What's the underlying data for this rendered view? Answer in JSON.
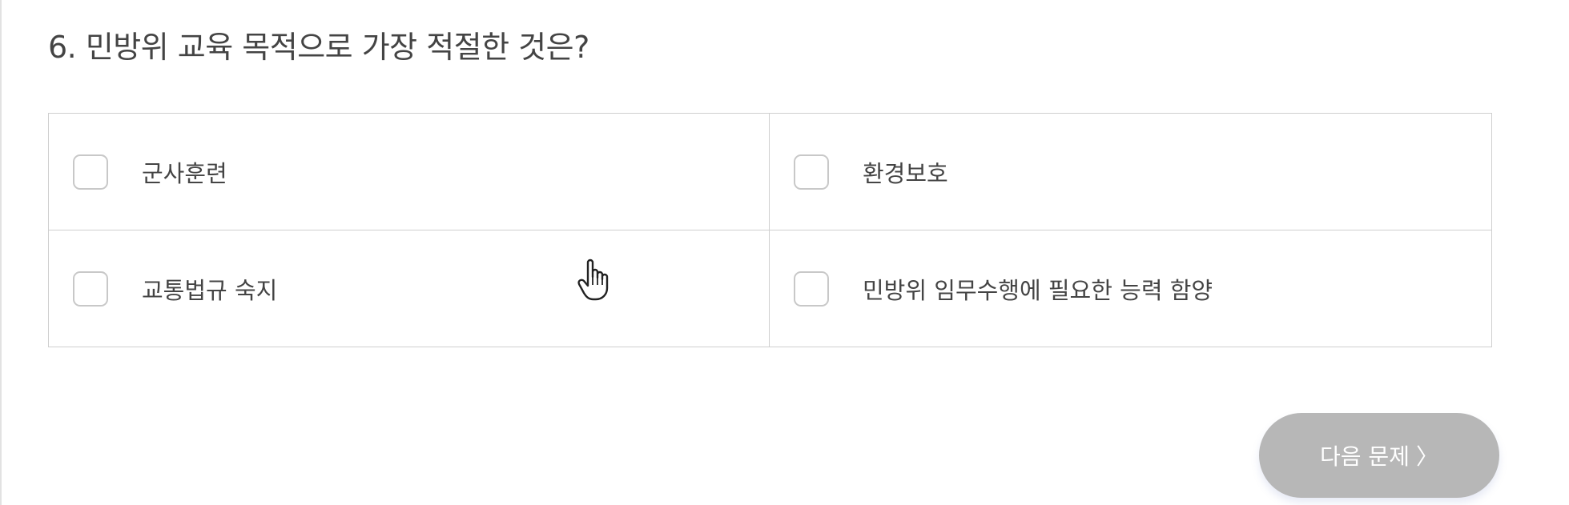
{
  "question": {
    "title": "6. 민방위 교육 목적으로 가장 적절한 것은?"
  },
  "options": [
    {
      "label": "군사훈련",
      "checked": false
    },
    {
      "label": "환경보호",
      "checked": false
    },
    {
      "label": "교통법규 숙지",
      "checked": false
    },
    {
      "label": "민방위 임무수행에 필요한 능력 함양",
      "checked": false
    }
  ],
  "next_button": {
    "label": "다음 문제",
    "icon": "chevron-right-icon",
    "glyph": "〉"
  },
  "colors": {
    "button_disabled": "#b7b7b7",
    "border": "#cfcfcf",
    "text": "#444444"
  }
}
